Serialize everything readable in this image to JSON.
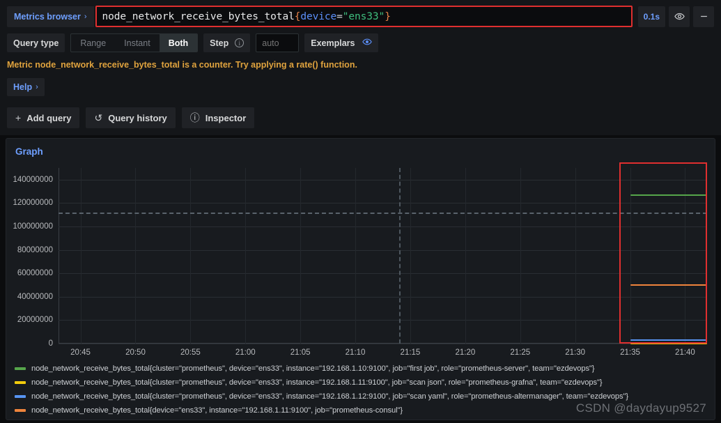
{
  "query_editor": {
    "metrics_browser_label": "Metrics browser",
    "metrics_browser_chevron": "›",
    "query_value": "node_network_receive_bytes_total{device=\"ens33\"}",
    "query_tokens": {
      "metric": "node_network_receive_bytes_total",
      "brace_open": "{",
      "label_key": "device",
      "equals": "=",
      "string_value": "\"ens33\"",
      "brace_close": "}"
    },
    "timing_badge": "0.1s",
    "eye_icon_name": "eye-icon",
    "collapse_icon": "—"
  },
  "query_type_row": {
    "query_type_label": "Query type",
    "options": [
      "Range",
      "Instant",
      "Both"
    ],
    "selected_option": "Both",
    "step_label": "Step",
    "step_info_icon": "i",
    "step_placeholder": "auto",
    "step_value": "",
    "exemplars_label": "Exemplars",
    "exemplars_eye": "◉"
  },
  "hint": {
    "text": "Metric node_network_receive_bytes_total is a counter. Try applying a rate() function.",
    "color": "#e0a33e"
  },
  "help": {
    "label": "Help",
    "chevron": "›"
  },
  "actions": [
    {
      "label": "Add query",
      "glyph": "+",
      "icon_name": "plus-icon"
    },
    {
      "label": "Query history",
      "glyph": "↺",
      "icon_name": "history-icon"
    },
    {
      "label": "Inspector",
      "glyph": "ⓘ",
      "icon_name": "info-circle-icon"
    }
  ],
  "panel": {
    "title": "Graph"
  },
  "chart_data": {
    "type": "line",
    "title": "Graph",
    "xlabel": "",
    "ylabel": "",
    "grid": true,
    "legend_position": "bottom",
    "ylim": [
      0,
      150000000
    ],
    "yticks": [
      0,
      20000000,
      40000000,
      60000000,
      80000000,
      100000000,
      120000000,
      140000000
    ],
    "ytick_labels": [
      "0",
      "20000000",
      "40000000",
      "60000000",
      "80000000",
      "100000000",
      "120000000",
      "140000000"
    ],
    "xticks": [
      "20:45",
      "20:50",
      "20:55",
      "21:00",
      "21:05",
      "21:10",
      "21:15",
      "21:20",
      "21:25",
      "21:30",
      "21:35",
      "21:40"
    ],
    "xlim": [
      "20:43",
      "21:42"
    ],
    "threshold_line": {
      "value": 112000000,
      "style": "dashed",
      "color": "#5a636c"
    },
    "cursor_line": {
      "x": "21:14",
      "style": "dashed",
      "color": "#4e575f"
    },
    "selection_box": {
      "x_start": "21:34",
      "x_end": "21:42",
      "color": "#e02f2f"
    },
    "series": [
      {
        "name": "node_network_receive_bytes_total{cluster=\"prometheus\", device=\"ens33\", instance=\"192.168.1.10:9100\", job=\"first job\", role=\"prometheus-server\", team=\"ezdevops\"}",
        "color": "#56a64b",
        "x_start": "21:35",
        "x_end": "21:42",
        "value": 127000000
      },
      {
        "name": "node_network_receive_bytes_total{cluster=\"prometheus\", device=\"ens33\", instance=\"192.168.1.11:9100\", job=\"scan json\", role=\"prometheus-grafna\", team=\"ezdevops\"}",
        "color": "#f2cc0c",
        "x_start": "21:35",
        "x_end": "21:42",
        "value": 0
      },
      {
        "name": "node_network_receive_bytes_total{cluster=\"prometheus\", device=\"ens33\", instance=\"192.168.1.12:9100\", job=\"scan yaml\", role=\"prometheus-altermanager\", team=\"ezdevops\"}",
        "color": "#5794f2",
        "x_start": "21:35",
        "x_end": "21:42",
        "value": 3000000
      },
      {
        "name": "node_network_receive_bytes_total{device=\"ens33\", instance=\"192.168.1.11:9100\", job=\"prometheus-consul\"}",
        "color": "#ef843c",
        "x_start": "21:35",
        "x_end": "21:42",
        "value": 50000000
      }
    ]
  },
  "watermark": "CSDN @daydayup9527"
}
